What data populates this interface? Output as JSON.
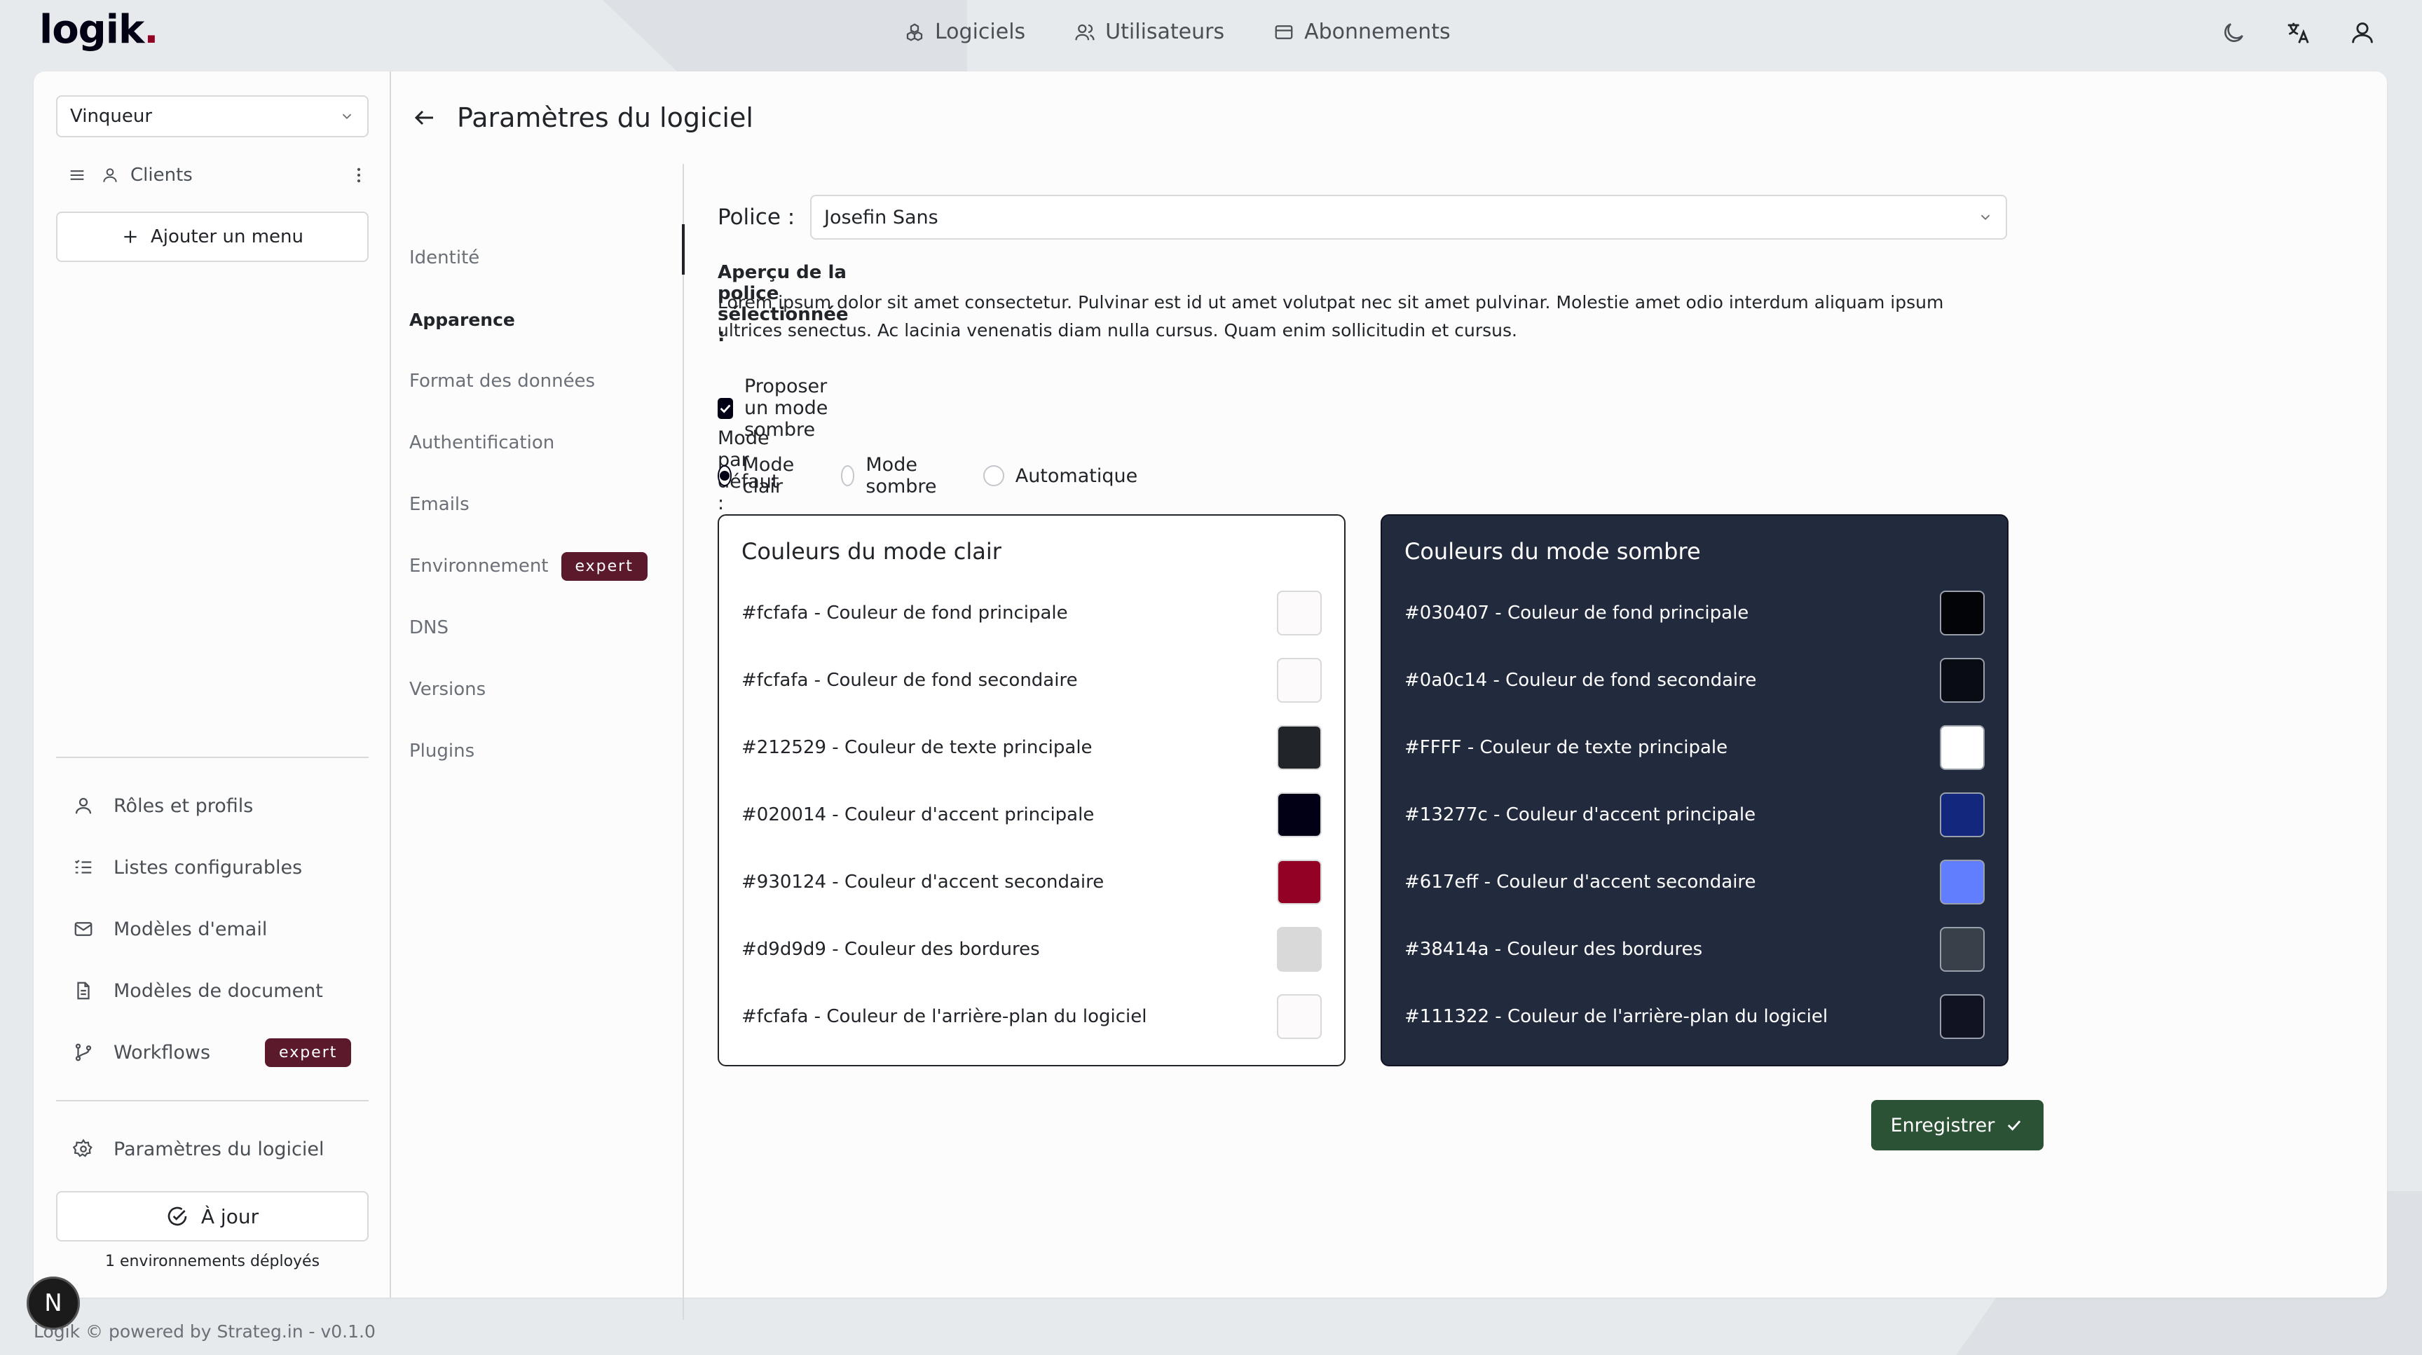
{
  "app": {
    "logo": "logik",
    "logo_dot": "."
  },
  "topnav": [
    {
      "label": "Logiciels",
      "icon": "cubes-icon"
    },
    {
      "label": "Utilisateurs",
      "icon": "users-icon"
    },
    {
      "label": "Abonnements",
      "icon": "card-icon"
    }
  ],
  "sidebar": {
    "client_select": "Vinqueur",
    "menu_label": "Clients",
    "add_menu": "Ajouter un menu",
    "items": [
      {
        "label": "Rôles et profils"
      },
      {
        "label": "Listes configurables"
      },
      {
        "label": "Modèles d'email"
      },
      {
        "label": "Modèles de document"
      },
      {
        "label": "Workflows",
        "badge": "expert"
      }
    ],
    "settings": "Paramètres du logiciel",
    "status": "À jour",
    "deployed": "1 environnements déployés"
  },
  "page": {
    "title": "Paramètres du logiciel"
  },
  "settings_nav": [
    {
      "label": "Identité"
    },
    {
      "label": "Apparence",
      "active": true
    },
    {
      "label": "Format des données"
    },
    {
      "label": "Authentification"
    },
    {
      "label": "Emails"
    },
    {
      "label": "Environnement",
      "badge": "expert"
    },
    {
      "label": "DNS"
    },
    {
      "label": "Versions"
    },
    {
      "label": "Plugins"
    }
  ],
  "appearance": {
    "font_label": "Police :",
    "font_value": "Josefin Sans",
    "preview_title": "Aperçu de la police sélectionnée :",
    "preview_text_1": "Lorem ipsum dolor sit amet consectetur. Pulvinar est id ut amet volutpat nec sit amet pulvinar. Molestie amet odio interdum aliquam ipsum",
    "preview_text_2": "ultrices senectus. Ac lacinia venenatis diam nulla cursus. Quam enim sollicitudin et cursus.",
    "dark_mode_checkbox": "Proposer un mode sombre",
    "default_mode_label": "Mode par défaut :",
    "modes": [
      {
        "label": "Mode clair",
        "selected": true
      },
      {
        "label": "Mode sombre",
        "selected": false
      },
      {
        "label": "Automatique",
        "selected": false
      }
    ],
    "light": {
      "title": "Couleurs du mode clair",
      "colors": [
        {
          "label": "#fcfafa - Couleur de fond principale",
          "hex": "#fcfafa"
        },
        {
          "label": "#fcfafa - Couleur de fond secondaire",
          "hex": "#fcfafa"
        },
        {
          "label": "#212529 - Couleur de texte principale",
          "hex": "#212529"
        },
        {
          "label": "#020014 - Couleur d'accent principale",
          "hex": "#020014"
        },
        {
          "label": "#930124 - Couleur d'accent secondaire",
          "hex": "#930124"
        },
        {
          "label": "#d9d9d9 - Couleur des bordures",
          "hex": "#d9d9d9"
        },
        {
          "label": "#fcfafa - Couleur de l'arrière-plan du logiciel",
          "hex": "#fcfafa"
        }
      ]
    },
    "dark": {
      "title": "Couleurs du mode sombre",
      "colors": [
        {
          "label": "#030407 - Couleur de fond principale",
          "hex": "#030407"
        },
        {
          "label": "#0a0c14 - Couleur de fond secondaire",
          "hex": "#0a0c14"
        },
        {
          "label": "#FFFF - Couleur de texte principale",
          "hex": "#FFFFFF"
        },
        {
          "label": "#13277c - Couleur d'accent principale",
          "hex": "#13277c"
        },
        {
          "label": "#617eff - Couleur d'accent secondaire",
          "hex": "#617eff"
        },
        {
          "label": "#38414a - Couleur des bordures",
          "hex": "#38414a"
        },
        {
          "label": "#111322 - Couleur de l'arrière-plan du logiciel",
          "hex": "#111322"
        }
      ]
    },
    "save": "Enregistrer"
  },
  "footer": "Logik © powered by Strateg.in - v0.1.0",
  "avatar_letter": "N"
}
